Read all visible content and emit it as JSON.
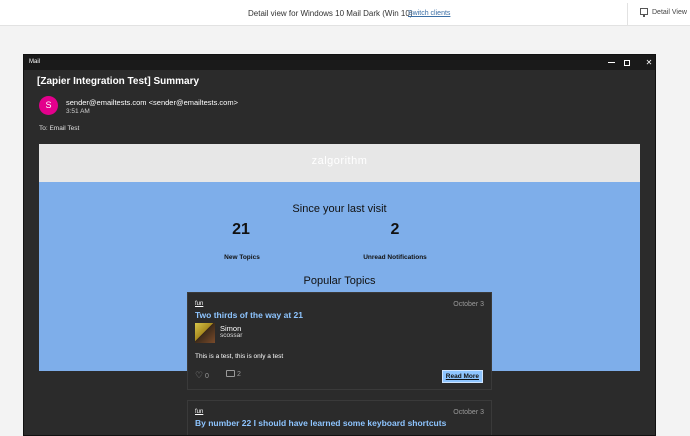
{
  "topbar": {
    "title": "Detail view for Windows 10 Mail Dark (Win 10)",
    "switch_link": "Switch clients",
    "detail_view": "Detail View"
  },
  "window": {
    "app_name": "Mail",
    "controls": [
      "minimize",
      "maximize",
      "close"
    ]
  },
  "message": {
    "subject": "[Zapier Integration Test] Summary",
    "avatar_letter": "S",
    "from": "sender@emailtests.com <sender@emailtests.com>",
    "time": "3:51 AM",
    "to": "To: Email Test"
  },
  "email": {
    "logo": "zalgorithm",
    "since_heading": "Since your last visit",
    "stats": [
      {
        "value": "21",
        "label": "New Topics"
      },
      {
        "value": "2",
        "label": "Unread Notifications"
      }
    ],
    "popular_heading": "Popular Topics",
    "topics": [
      {
        "category": "fun",
        "date": "October 3",
        "title": "Two thirds of the way at 21",
        "user_name": "Simon",
        "user_handle": "scossar",
        "excerpt": "This is a test, this is only a test",
        "likes": "0",
        "replies": "2",
        "read_more": "Read More"
      },
      {
        "category": "fun",
        "date": "October 3",
        "title": "By number 22 I should have learned some keyboard shortcuts"
      }
    ]
  },
  "colors": {
    "avatar": "#e3008c",
    "banner_blue": "#7eaeea",
    "link_blue": "#8ec5ff",
    "window_dark": "#2b2b2b"
  }
}
